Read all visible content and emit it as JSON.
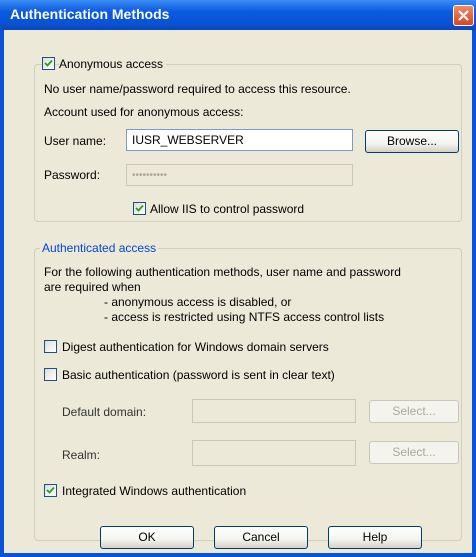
{
  "window": {
    "title": "Authentication Methods"
  },
  "anonymous": {
    "checkbox_label": "Anonymous access",
    "checked": true,
    "description": "No user name/password required to access this resource.",
    "account_heading": "Account used for anonymous access:",
    "username_label": "User name:",
    "username_value": "IUSR_WEBSERVER",
    "browse_label": "Browse...",
    "password_label": "Password:",
    "password_value": "••••••••••",
    "allow_iis_label": "Allow IIS to control password",
    "allow_iis_checked": true
  },
  "authenticated": {
    "legend": "Authenticated access",
    "description_line1": "For the following authentication methods, user name and password",
    "description_line2": "are required when",
    "bullet1": "- anonymous access is disabled, or",
    "bullet2": "- access is restricted using NTFS access control lists",
    "digest_label": "Digest authentication for Windows domain servers",
    "digest_checked": false,
    "basic_label": "Basic authentication (password is sent in clear text)",
    "basic_checked": false,
    "default_domain_label": "Default domain:",
    "default_domain_value": "",
    "realm_label": "Realm:",
    "realm_value": "",
    "select_label": "Select...",
    "integrated_label": "Integrated Windows authentication",
    "integrated_checked": true
  },
  "footer": {
    "ok_label": "OK",
    "cancel_label": "Cancel",
    "help_label": "Help"
  }
}
